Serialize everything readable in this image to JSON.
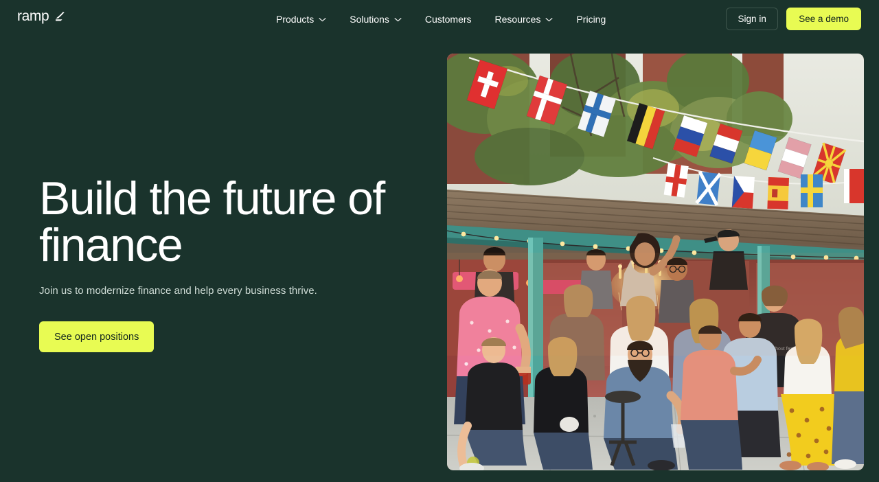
{
  "brand": {
    "word": "ramp",
    "mark_icon": "ramp-wedge-icon"
  },
  "nav": {
    "items": [
      {
        "label": "Products",
        "has_menu": true,
        "icon": "chevron-down-icon"
      },
      {
        "label": "Solutions",
        "has_menu": true,
        "icon": "chevron-down-icon"
      },
      {
        "label": "Customers",
        "has_menu": false,
        "icon": ""
      },
      {
        "label": "Resources",
        "has_menu": true,
        "icon": "chevron-down-icon"
      },
      {
        "label": "Pricing",
        "has_menu": false,
        "icon": ""
      }
    ],
    "sign_in_label": "Sign in",
    "demo_label": "See a demo"
  },
  "hero": {
    "title": "Build the future of\nfinance",
    "subtitle": "Join us to modernize finance and help every business thrive.",
    "cta_label": "See open positions"
  },
  "photo": {
    "alt": "Large group team photo of Ramp employees gathered under an outdoor patio canopy decorated with international bunting flags and a chandelier",
    "bunting_flags": [
      "Switzerland",
      "Denmark",
      "Finland",
      "Belgium",
      "Russia",
      "Netherlands",
      "Ukraine",
      "Austria",
      "North Macedonia",
      "England",
      "Scotland",
      "Czech Republic",
      "Spain",
      "Sweden"
    ],
    "shirt_text": "Career without fear"
  },
  "colors": {
    "background": "#1a332c",
    "accent_yellow": "#e8fb53",
    "text_primary": "#ffffff",
    "text_secondary": "#cfdcd6",
    "button_text_dark": "#10231d",
    "border_subtle": "#3e564d"
  }
}
